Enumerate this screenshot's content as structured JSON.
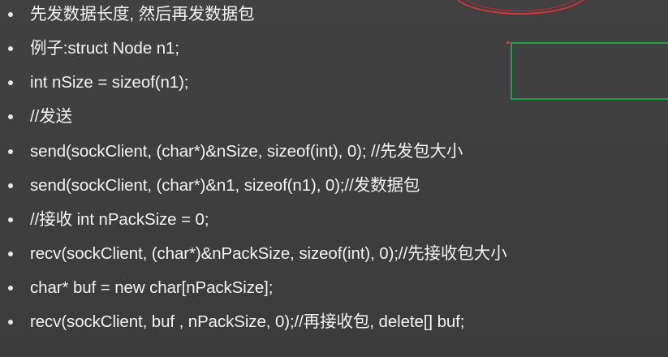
{
  "bullets": [
    {
      "text": "先发数据长度, 然后再发数据包"
    },
    {
      "text": "例子:struct Node n1;"
    },
    {
      "text": "int nSize = sizeof(n1);"
    },
    {
      "text": "//发送"
    },
    {
      "text": "send(sockClient, (char*)&nSize, sizeof(int), 0);  //先发包大小"
    },
    {
      "text": "send(sockClient, (char*)&n1, sizeof(n1), 0);//发数据包"
    },
    {
      "text": "//接收 int nPackSize = 0;"
    },
    {
      "text": "recv(sockClient, (char*)&nPackSize, sizeof(int), 0);//先接收包大小"
    },
    {
      "text": "char* buf = new char[nPackSize];"
    },
    {
      "text": "recv(sockClient, buf , nPackSize, 0);//再接收包,  delete[] buf;"
    }
  ],
  "colors": {
    "background": "#3e3e3e",
    "text": "#f2f2f2",
    "annotation_red": "#d8323a",
    "annotation_green": "#1fa04a"
  }
}
